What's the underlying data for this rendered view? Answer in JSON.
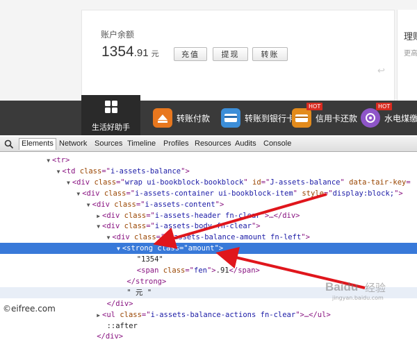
{
  "account": {
    "balance_label": "账户余额",
    "balance_integer": "1354",
    "balance_fen": ".91",
    "balance_unit": "元",
    "actions": [
      "充值",
      "提现",
      "转账"
    ],
    "right_title": "理财",
    "right_sub": "更高"
  },
  "services": {
    "active_label": "生活好助手",
    "items": [
      {
        "label": "转账付款",
        "icon": "transfer-icon",
        "hot": false
      },
      {
        "label": "转账到银行卡",
        "icon": "bank-card-icon",
        "hot": false
      },
      {
        "label": "信用卡还款",
        "icon": "credit-card-icon",
        "hot": true
      },
      {
        "label": "水电煤缴费",
        "icon": "utility-icon",
        "hot": true
      }
    ],
    "hot_badge": "HOT"
  },
  "devtools": {
    "tabs": [
      "Elements",
      "Network",
      "Sources",
      "Timeline",
      "Profiles",
      "Resources",
      "Audits",
      "Console"
    ],
    "active_tab": "Elements",
    "lines": [
      {
        "indent": 6,
        "tri": "▼",
        "parts": [
          [
            "t",
            "<tr>"
          ]
        ]
      },
      {
        "indent": 8,
        "tri": "▼",
        "parts": [
          [
            "t",
            "<td "
          ],
          [
            "an",
            "class"
          ],
          [
            "t",
            "=\""
          ],
          [
            "av",
            "i-assets-balance"
          ],
          [
            "t",
            "\">"
          ]
        ]
      },
      {
        "indent": 10,
        "tri": "▼",
        "parts": [
          [
            "t",
            "<div "
          ],
          [
            "an",
            "class"
          ],
          [
            "t",
            "=\""
          ],
          [
            "av",
            "wrap ui-bookblock-bookblock"
          ],
          [
            "t",
            "\" "
          ],
          [
            "an",
            "id"
          ],
          [
            "t",
            "=\""
          ],
          [
            "av",
            "J-assets-balance"
          ],
          [
            "t",
            "\" "
          ],
          [
            "an",
            "data-tair-key"
          ],
          [
            "t",
            "="
          ]
        ]
      },
      {
        "indent": 12,
        "tri": "▼",
        "parts": [
          [
            "t",
            "<div "
          ],
          [
            "an",
            "class"
          ],
          [
            "t",
            "=\""
          ],
          [
            "av",
            "i-assets-container ui-bookblock-item"
          ],
          [
            "t",
            "\" "
          ],
          [
            "an",
            "style"
          ],
          [
            "t",
            "=\""
          ],
          [
            "av",
            "display:block;"
          ],
          [
            "t",
            "\">"
          ]
        ]
      },
      {
        "indent": 14,
        "tri": "▼",
        "parts": [
          [
            "t",
            "<div "
          ],
          [
            "an",
            "class"
          ],
          [
            "t",
            "=\""
          ],
          [
            "av",
            "i-assets-content"
          ],
          [
            "t",
            "\">"
          ]
        ]
      },
      {
        "indent": 16,
        "tri": "▶",
        "parts": [
          [
            "t",
            "<div "
          ],
          [
            "an",
            "class"
          ],
          [
            "t",
            "=\""
          ],
          [
            "av",
            "i-assets-header fn-clear"
          ],
          [
            "t",
            "\">…</div>"
          ]
        ]
      },
      {
        "indent": 16,
        "tri": "▼",
        "parts": [
          [
            "t",
            "<div "
          ],
          [
            "an",
            "class"
          ],
          [
            "t",
            "=\""
          ],
          [
            "av",
            "i-assets-body fn-clear"
          ],
          [
            "t",
            "\">"
          ]
        ]
      },
      {
        "indent": 18,
        "tri": "▼",
        "parts": [
          [
            "t",
            "<div "
          ],
          [
            "an",
            "class"
          ],
          [
            "t",
            "=\""
          ],
          [
            "av",
            "i-assets-balance-amount fn-left"
          ],
          [
            "t",
            "\">"
          ]
        ]
      },
      {
        "indent": 20,
        "tri": "▼",
        "parts": [
          [
            "t",
            "<strong "
          ],
          [
            "an",
            "class"
          ],
          [
            "t",
            "=\""
          ],
          [
            "av",
            "amount"
          ],
          [
            "t",
            "\">"
          ]
        ],
        "selected": true
      },
      {
        "indent": 24,
        "tri": "",
        "parts": [
          [
            "tx",
            "\"1354\""
          ]
        ]
      },
      {
        "indent": 24,
        "tri": "",
        "parts": [
          [
            "t",
            "<span "
          ],
          [
            "an",
            "class"
          ],
          [
            "t",
            "=\""
          ],
          [
            "av",
            "fen"
          ],
          [
            "t",
            "\">"
          ],
          [
            "tx",
            ".91"
          ],
          [
            "t",
            "</span>"
          ]
        ]
      },
      {
        "indent": 22,
        "tri": "",
        "parts": [
          [
            "t",
            "</strong>"
          ]
        ]
      },
      {
        "indent": 22,
        "tri": "",
        "parts": [
          [
            "tx",
            "\" 元 \""
          ]
        ],
        "hover": true
      },
      {
        "indent": 18,
        "tri": "",
        "parts": [
          [
            "t",
            "</div>"
          ]
        ]
      },
      {
        "indent": 16,
        "tri": "▶",
        "parts": [
          [
            "t",
            "<ul "
          ],
          [
            "an",
            "class"
          ],
          [
            "t",
            "=\""
          ],
          [
            "av",
            "i-assets-balance-actions fn-clear"
          ],
          [
            "t",
            "\">…</ul>"
          ]
        ]
      },
      {
        "indent": 18,
        "tri": "",
        "parts": [
          [
            "tx",
            "::after"
          ]
        ]
      },
      {
        "indent": 16,
        "tri": "",
        "parts": [
          [
            "t",
            "</div>"
          ]
        ]
      }
    ]
  },
  "watermarks": {
    "left": "©eifree.com",
    "baidu_logo": "Baidu",
    "baidu_jingyan": "经验",
    "baidu_url": "jingyan.baidu.com"
  },
  "colors": {
    "nav_bg": "#3a3a3a",
    "selection": "#3879d9",
    "arrow": "#e0161c"
  }
}
